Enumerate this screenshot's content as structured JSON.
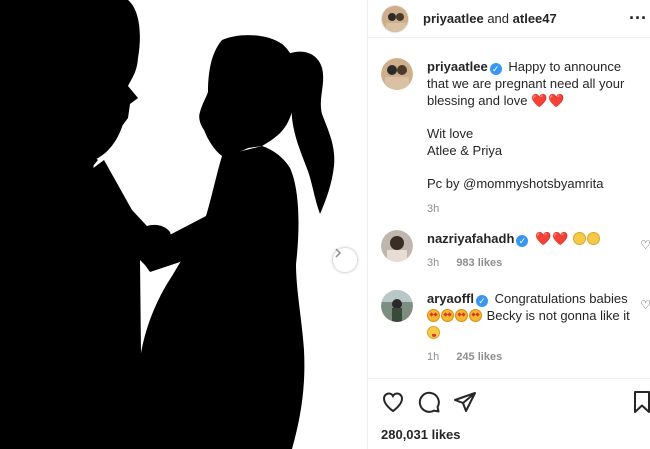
{
  "header": {
    "username": "priyaatlee",
    "and": "and",
    "coauthor": "atlee47",
    "more_icon": "more-horizontal-icon"
  },
  "caption": {
    "username": "priyaatlee",
    "text": "Happy to announce that we are pregnant need all your blessing and love",
    "hearts": "❤️❤️",
    "line2": "Wit love",
    "line3": "Atlee & Priya",
    "line4": "Pc by @mommyshotsbyamrita",
    "time": "3h"
  },
  "comments": [
    {
      "username": "nazriyafahadh",
      "hearts": "❤️❤️",
      "time": "3h",
      "likes": "983 likes"
    },
    {
      "username": "aryaoffl",
      "text1": "Congratulations babies",
      "text2": "Becky is not gonna like it",
      "time": "1h",
      "likes": "245 likes"
    }
  ],
  "actions": {
    "like_icon": "heart-icon",
    "comment_icon": "comment-icon",
    "share_icon": "send-icon",
    "save_icon": "bookmark-icon"
  },
  "likes_count": "280,031 likes",
  "colors": {
    "verified": "#3897f0",
    "heart": "#ed1c24",
    "muted": "#8e8e8e",
    "text": "#262626"
  }
}
